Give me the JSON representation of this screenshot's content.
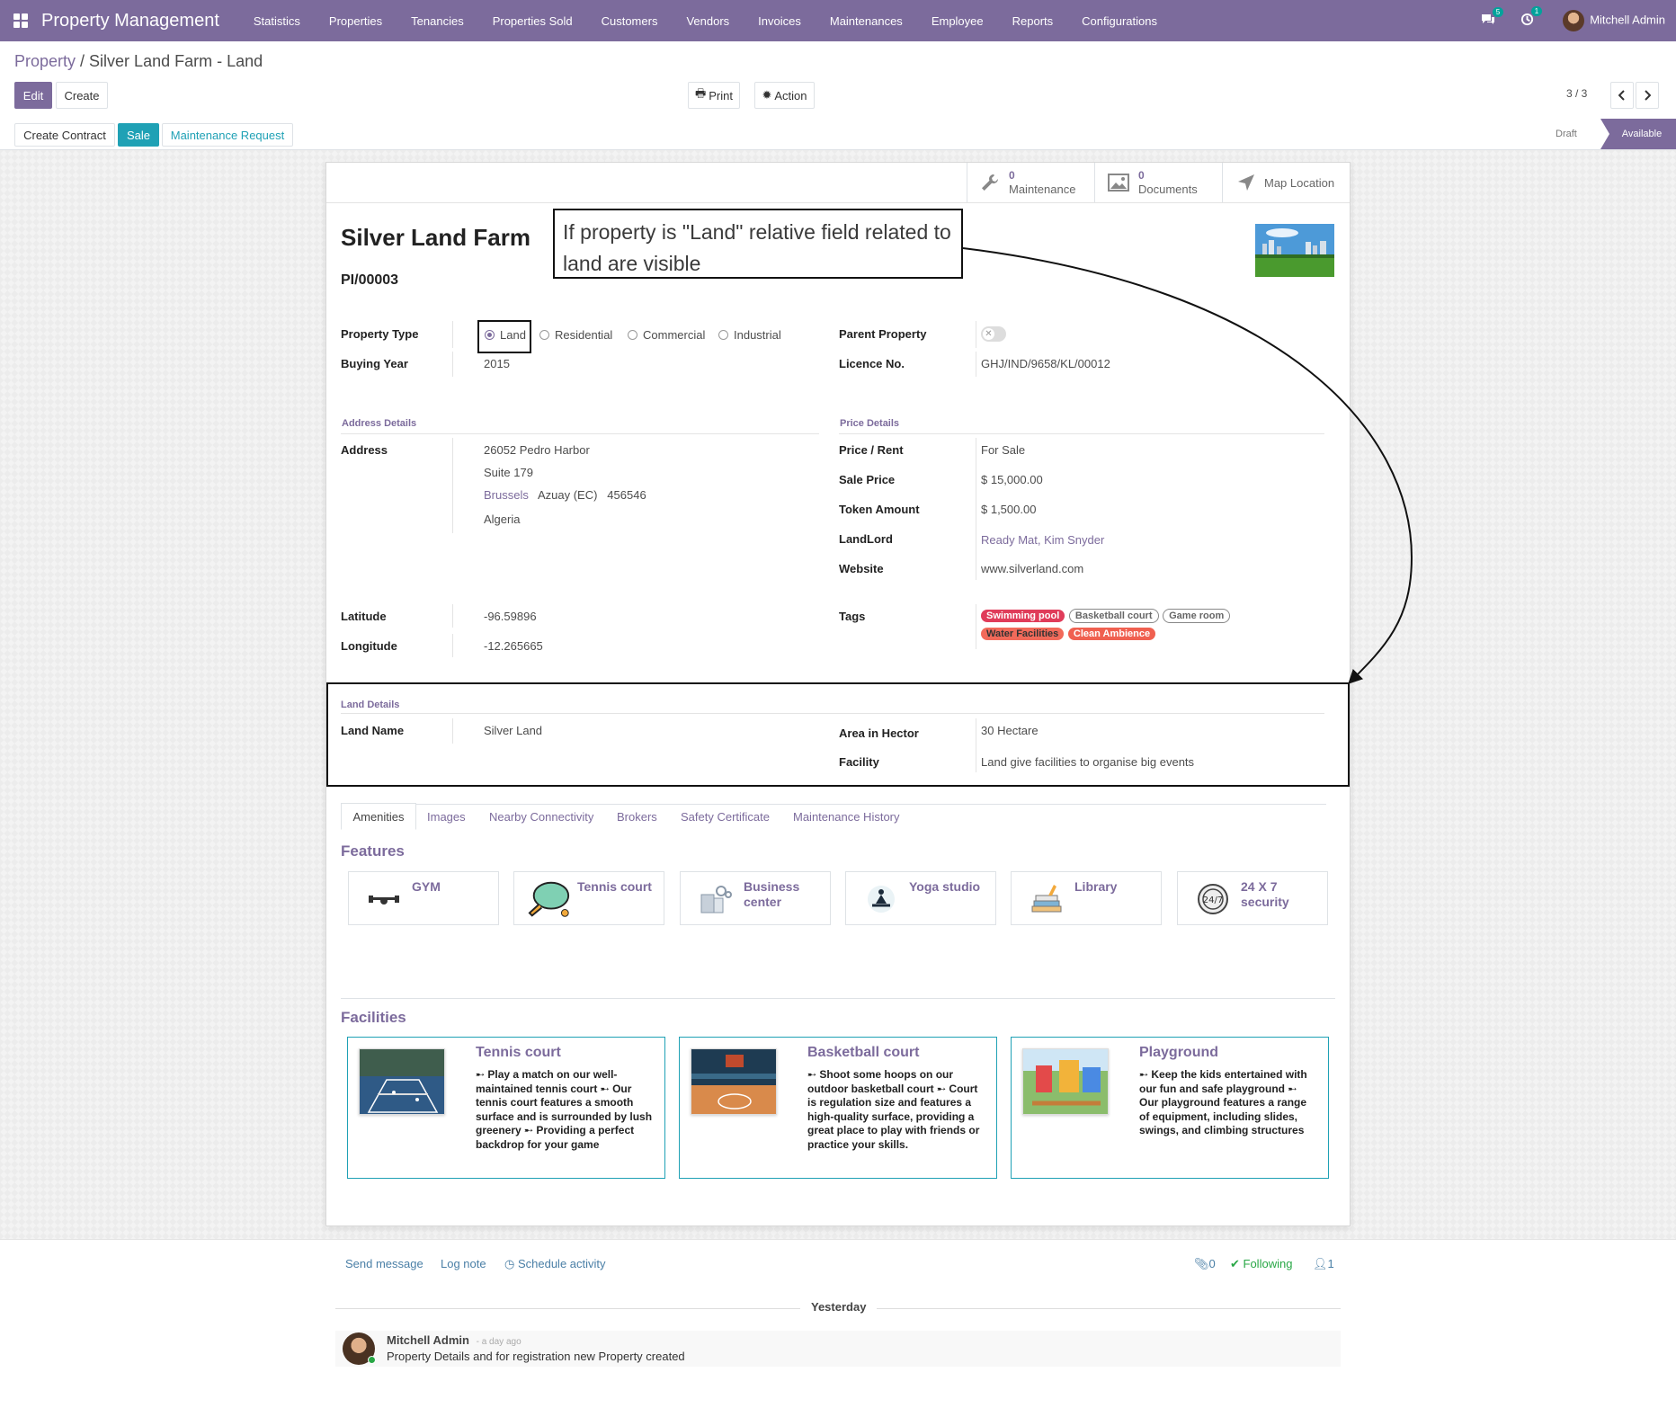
{
  "navbar": {
    "brand": "Property Management",
    "menus": [
      "Statistics",
      "Properties",
      "Tenancies",
      "Properties Sold",
      "Customers",
      "Vendors",
      "Invoices",
      "Maintenances",
      "Employee",
      "Reports",
      "Configurations"
    ],
    "messages_count": "5",
    "activities_count": "1",
    "user_name": "Mitchell Admin"
  },
  "breadcrumb": {
    "parent": "Property",
    "current": "Silver Land Farm - Land"
  },
  "actions": {
    "edit": "Edit",
    "create": "Create",
    "print": "Print",
    "action": "Action",
    "pager": "3 / 3",
    "create_contract": "Create Contract",
    "sale": "Sale",
    "maintenance_request": "Maintenance Request"
  },
  "status": {
    "draft": "Draft",
    "available": "Available"
  },
  "smart_buttons": {
    "maintenance_count": "0",
    "maintenance_label": "Maintenance",
    "documents_count": "0",
    "documents_label": "Documents",
    "map_label": "Map Location"
  },
  "annotation": "If property is \"Land\" relative field related to land are visible",
  "property": {
    "name": "Silver Land Farm",
    "code": "PI/00003",
    "type_label": "Property Type",
    "types": [
      "Land",
      "Residential",
      "Commercial",
      "Industrial"
    ],
    "buying_year_label": "Buying Year",
    "buying_year": "2015",
    "parent_label": "Parent Property",
    "licence_label": "Licence No.",
    "licence": "GHJ/IND/9658/KL/00012"
  },
  "address": {
    "section": "Address Details",
    "label": "Address",
    "street": "26052 Pedro Harbor",
    "street2": "Suite 179",
    "city": "Brussels",
    "state": "Azuay (EC)",
    "zip": "456546",
    "country": "Algeria",
    "latitude_label": "Latitude",
    "latitude": "-96.59896",
    "longitude_label": "Longitude",
    "longitude": "-12.265665"
  },
  "price": {
    "section": "Price Details",
    "price_rent_label": "Price / Rent",
    "price_rent": "For Sale",
    "sale_price_label": "Sale Price",
    "sale_price": "$ 15,000.00",
    "token_label": "Token Amount",
    "token": "$ 1,500.00",
    "landlord_label": "LandLord",
    "landlord": "Ready Mat, Kim Snyder",
    "website_label": "Website",
    "website": "www.silverland.com",
    "tags_label": "Tags",
    "tags": [
      "Swimming pool",
      "Basketball court",
      "Game room",
      "Water Facilities",
      "Clean Ambience"
    ]
  },
  "land": {
    "section": "Land Details",
    "name_label": "Land Name",
    "name": "Silver Land",
    "area_label": "Area in Hector",
    "area": "30 Hectare",
    "facility_label": "Facility",
    "facility": "Land give facilities to organise big events"
  },
  "tabs": [
    "Amenities",
    "Images",
    "Nearby Connectivity",
    "Brokers",
    "Safety Certificate",
    "Maintenance History"
  ],
  "features": {
    "title": "Features",
    "items": [
      "GYM",
      "Tennis court",
      "Business center",
      "Yoga studio",
      "Library",
      "24 X 7 security"
    ]
  },
  "facilities": {
    "title": "Facilities",
    "items": [
      {
        "title": "Tennis court",
        "desc": "➸ Play a match on our well-maintained tennis court ➸ Our tennis court features a smooth surface and is surrounded by lush greenery ➸ Providing a perfect backdrop for your game"
      },
      {
        "title": "Basketball court",
        "desc": "➸ Shoot some hoops on our outdoor basketball court ➸ Court is regulation size and features a high-quality surface, providing a great place to play with friends or practice your skills."
      },
      {
        "title": "Playground",
        "desc": "➸ Keep the kids entertained with our fun and safe playground ➸ Our playground features a range of equipment, including slides, swings, and climbing structures"
      }
    ]
  },
  "chatter": {
    "send_message": "Send message",
    "log_note": "Log note",
    "schedule": "Schedule activity",
    "attachments": "0",
    "following": "Following",
    "followers": "1",
    "date_sep": "Yesterday",
    "author": "Mitchell Admin",
    "time": "- a day ago",
    "body": "Property Details and for registration new Property created"
  },
  "colors": {
    "primary": "#7c6b9c",
    "info": "#1fa1b5",
    "tag_red": "#e03c5a",
    "tag_orange": "#f06050"
  }
}
